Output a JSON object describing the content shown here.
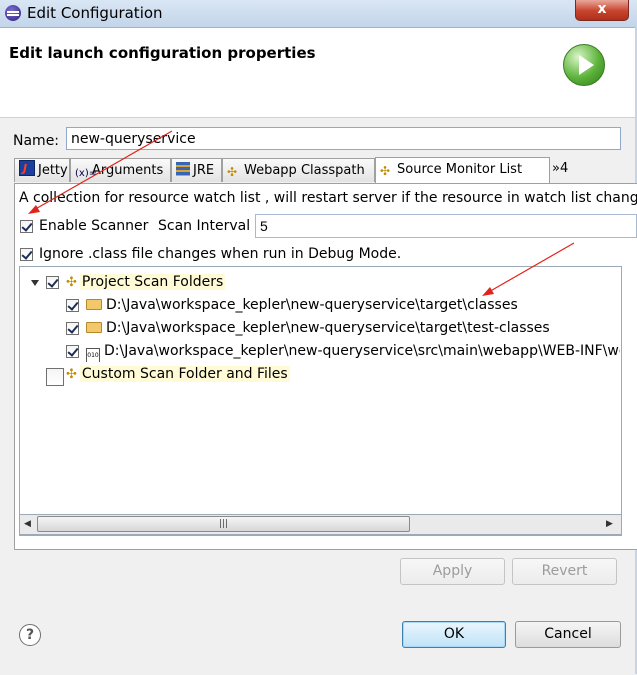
{
  "window": {
    "title": "Edit Configuration",
    "close_label": "x"
  },
  "header": {
    "title": "Edit launch configuration properties"
  },
  "name_field": {
    "label": "Name:",
    "value": "new-queryservice"
  },
  "tabs": [
    {
      "label": "Jetty",
      "icon": "jetty-icon"
    },
    {
      "label": "Arguments",
      "icon_text": "(x)=",
      "icon": "arguments-icon"
    },
    {
      "label": "JRE",
      "icon": "jre-icon"
    },
    {
      "label": "Webapp Classpath",
      "icon": "classpath-icon"
    },
    {
      "label": "Source Monitor List",
      "icon": "source-monitor-icon"
    }
  ],
  "tab_overflow": "»4",
  "panel": {
    "description": "A collection for resource watch list , will restart server if the resource in watch list change",
    "enable_scanner": {
      "label": "Enable Scanner",
      "checked": true
    },
    "scan_interval": {
      "label": "Scan Interval",
      "value": "5"
    },
    "ignore_class": {
      "label": "Ignore .class file changes when run in Debug Mode.",
      "checked": true
    }
  },
  "tree": {
    "project_scan": {
      "label": "Project Scan Folders",
      "checked": true
    },
    "items": [
      {
        "path": "D:\\Java\\workspace_kepler\\new-queryservice\\target\\classes",
        "icon": "folder-icon"
      },
      {
        "path": "D:\\Java\\workspace_kepler\\new-queryservice\\target\\test-classes",
        "icon": "folder-icon"
      },
      {
        "path": "D:\\Java\\workspace_kepler\\new-queryservice\\src\\main\\webapp\\WEB-INF\\web.xml",
        "icon": "web-xml-icon"
      }
    ],
    "custom_scan": {
      "label": "Custom Scan Folder and Files",
      "checked": false
    }
  },
  "scrollbar": {
    "thumb_grip": "|||"
  },
  "buttons": {
    "apply": "Apply",
    "revert": "Revert",
    "ok": "OK",
    "cancel": "Cancel"
  },
  "help_glyph": "?",
  "colors": {
    "annotation_arrow": "#e0241b",
    "highlight": "#fffbd6"
  }
}
